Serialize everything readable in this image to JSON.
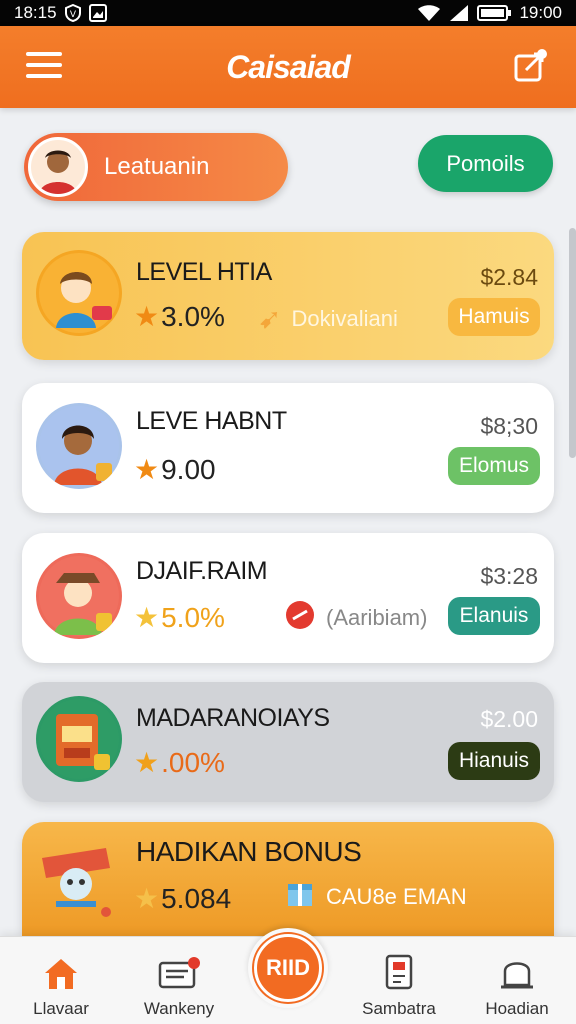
{
  "status_bar": {
    "time_left": "18:15",
    "time_right": "19:00"
  },
  "header": {
    "title": "Caisaiad"
  },
  "user": {
    "name": "Leatuanin"
  },
  "promo_button": "Pomoils",
  "cards": [
    {
      "title": "LEVEL HTIA",
      "rating": "3.0%",
      "sub_label": "Dokivaliani",
      "price": "$2.84",
      "action": "Hamuis",
      "bg": "#f8c350",
      "action_color": "#f8b840"
    },
    {
      "title": "LEVE HABNT",
      "rating": "9.00",
      "price": "$8;30",
      "action": "Elomus",
      "bg": "#ffffff",
      "action_color": "#6dc266"
    },
    {
      "title": "DJAIF.RAIM",
      "rating": "5.0%",
      "sub_label": "(Aaribiam)",
      "price": "$3:28",
      "action": "Elanuis",
      "bg": "#ffffff",
      "action_color": "#2a9a86"
    },
    {
      "title": "MADARANOIAYS",
      "rating": ".00%",
      "price": "$2.00",
      "action": "Hianuis",
      "bg": "#d2d4d8",
      "action_color": "#2c3b14"
    },
    {
      "title": "HADIKAN BONUS",
      "rating": "5.084",
      "sub_label": "CAU8e EMAN",
      "bg": "#f4a73a"
    }
  ],
  "nav": {
    "home": "Llavaar",
    "wallet": "Wankeny",
    "center": "RIID",
    "sambira": "Sambatra",
    "hoadian": "Hoadian"
  },
  "colors": {
    "accent": "#f26b22",
    "header": "#f47e2b",
    "promo_green": "#1aa56a"
  }
}
